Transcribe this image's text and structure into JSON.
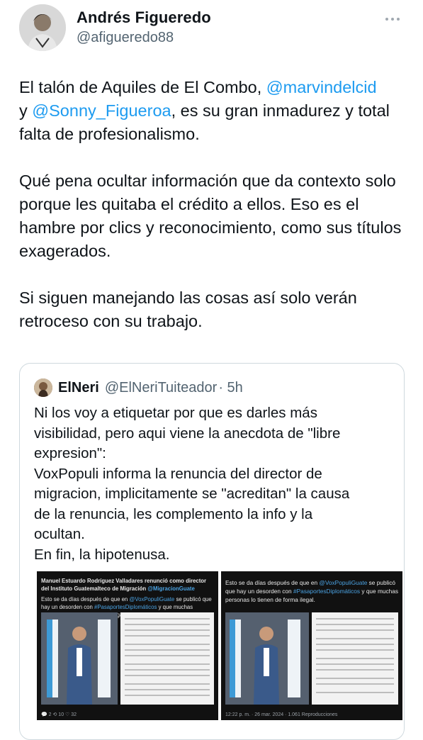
{
  "author": {
    "name": "Andrés Figueredo",
    "handle": "@afigueredo88"
  },
  "tweet": {
    "p1_a": "El talón de Aquiles de El Combo, ",
    "p1_mention1": "@marvindelcid",
    "p1_b": "y ",
    "p1_mention2": "@Sonny_Figueroa",
    "p1_c": ", es su gran inmadurez y total falta de profesionalismo.",
    "p2": "Qué pena ocultar información que da contexto solo porque les quitaba el crédito a ellos. Eso es el hambre por clics y reconocimiento, como sus títulos exagerados.",
    "p3": "Si siguen manejando las cosas así solo verán retroceso con su trabajo."
  },
  "quote": {
    "name": "ElNeri",
    "handle": "@ElNeriTuiteador",
    "time": "· 5h",
    "lines": [
      "Ni los voy a etiquetar por que es darles más",
      "visibilidad, pero aqui viene la anecdota de \"libre",
      "expresion\":",
      "VoxPopuli informa la renuncia del director de",
      "migracion, implicitamente se \"acreditan\" la causa",
      "de la renuncia, les complemento la info y la",
      "ocultan.",
      "En fin, la hipotenusa."
    ]
  },
  "media": {
    "left": {
      "heading": "Manuel Estuardo Rodríguez Valladares renunció como director del Instituto Guatemalteco de Migración",
      "heading_link": "@MigracionGuate",
      "text_a": "Esto se da días después de que en",
      "link1": "@VoxPopuliGuate",
      "text_b": "se publicó que hay un desorden con",
      "link2": "#PasaportesDiplomáticos",
      "text_c": "y que muchas personas lo tienen de forma ilegal.",
      "footer": "💬 2     ⟲ 10     ♡ 32"
    },
    "right": {
      "text_a": "Esto se da días después de que en",
      "link1": "@VoxPopuliGuate",
      "text_b": "se publicó que hay un desorden con",
      "link2": "#PasaportesDiplomáticos",
      "text_c": "y que muchas personas lo tienen de forma ilegal.",
      "footer": "12:22 p. m. · 26 mar. 2024 · 1.061 Reproducciones"
    }
  },
  "colors": {
    "link": "#1d9bf0",
    "muted": "#536471"
  }
}
